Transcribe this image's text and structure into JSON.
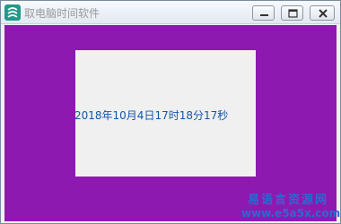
{
  "window": {
    "title": "取电脑时间软件",
    "app_icon": "app-logo-icon",
    "controls": {
      "minimize_icon": "minimize-icon",
      "maximize_icon": "maximize-icon",
      "close_icon": "close-icon"
    }
  },
  "content": {
    "datetime_text": "2018年10月4日17时18分17秒"
  },
  "watermark": {
    "site_name": "易语言资源网",
    "url": "www.e5a5x.com"
  },
  "colors": {
    "client_background": "#8e19b1",
    "panel_background": "#f0f0f0",
    "datetime_text": "#1257a8",
    "watermark": "#1f6fd1"
  }
}
